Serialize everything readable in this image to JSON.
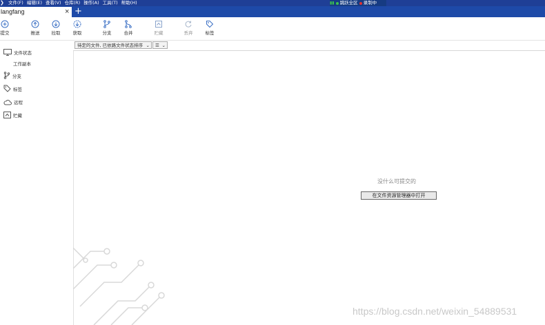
{
  "menubar": {
    "items": [
      "文件(F)",
      "编辑(E)",
      "查看(V)",
      "仓库(R)",
      "操作(A)",
      "工具(T)",
      "帮助(H)"
    ],
    "status": {
      "left": "跳跃全区",
      "right": "录制中",
      "colors": {
        "green": "#3cc050",
        "red": "#e03030"
      }
    }
  },
  "tab": {
    "title": "langfang",
    "close": "×",
    "add": "+"
  },
  "toolbar": {
    "commit": "提交",
    "push": "推送",
    "pull": "拉取",
    "fetch": "获取",
    "branch": "分支",
    "merge": "合并",
    "stash": "贮藏",
    "discard": "丢弃",
    "tag": "标签"
  },
  "sidebar": {
    "file_status": "文件状态",
    "working_copy": "工作副本",
    "branches": "分支",
    "tags": "标签",
    "remotes": "远程",
    "stashes": "贮藏"
  },
  "filter": {
    "selected": "待定的文件, 已依路文件状态排序",
    "view": "☰"
  },
  "main": {
    "empty_text": "没什么可提交的",
    "open_button": "在文件资源管理器中打开"
  },
  "watermark": "https://blog.csdn.net/weixin_54889531",
  "colors": {
    "menubar": "#1f3f96",
    "tabbar": "#1e4aa8",
    "icon": "#3a6fc4"
  }
}
